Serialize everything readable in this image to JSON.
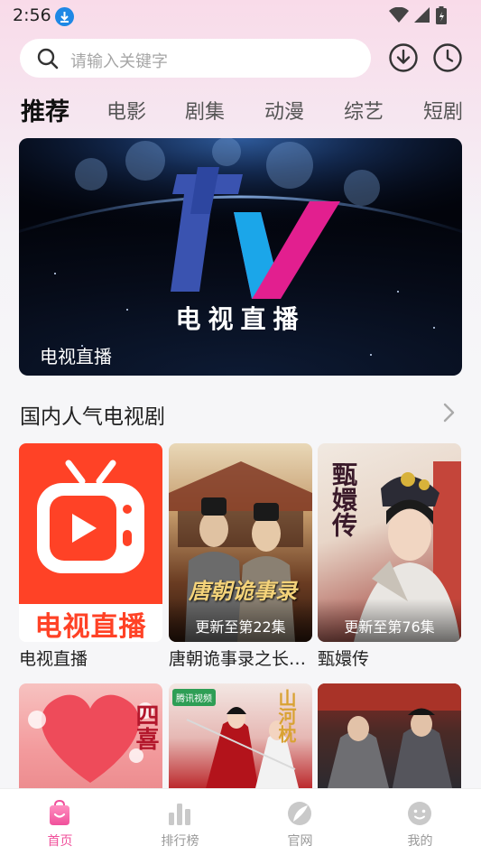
{
  "status": {
    "time": "2:56"
  },
  "search": {
    "placeholder": "请输入关键字"
  },
  "tabs": [
    {
      "label": "推荐",
      "active": true
    },
    {
      "label": "电影"
    },
    {
      "label": "剧集"
    },
    {
      "label": "动漫"
    },
    {
      "label": "综艺"
    },
    {
      "label": "短剧"
    }
  ],
  "banner": {
    "logo_text": "tv",
    "subtitle": "电视直播",
    "title": "电视直播"
  },
  "section": {
    "title": "国内人气电视剧"
  },
  "cards": [
    {
      "title": "电视直播",
      "poster_text": "电视直播",
      "badge": ""
    },
    {
      "title": "唐朝诡事录之长…",
      "poster_text": "唐朝诡事录",
      "badge": "更新至第22集"
    },
    {
      "title": "甄嬛传",
      "poster_text": "甄嬛传",
      "badge": "更新至第76集"
    }
  ],
  "more_cards": [
    {
      "poster_text": "四喜"
    },
    {
      "poster_text": "山河枕",
      "tag": "腾讯视频"
    },
    {
      "poster_text": ""
    }
  ],
  "bottom_nav": [
    {
      "label": "首页",
      "icon": "home-icon",
      "active": true
    },
    {
      "label": "排行榜",
      "icon": "ranking-icon"
    },
    {
      "label": "官网",
      "icon": "website-icon"
    },
    {
      "label": "我的",
      "icon": "profile-icon"
    }
  ],
  "colors": {
    "accent": "#f0509b",
    "download_badge": "#1e88e5"
  }
}
